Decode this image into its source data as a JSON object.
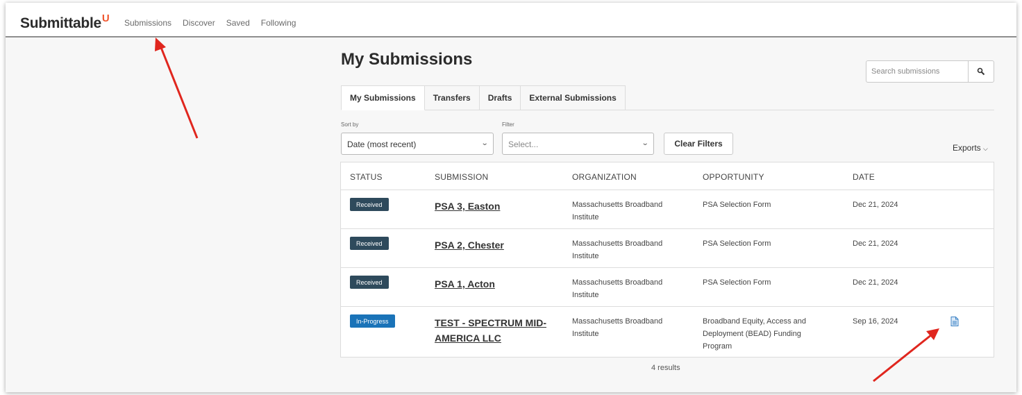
{
  "app": {
    "logo": "Submittable",
    "logo_mark": "U"
  },
  "nav": {
    "items": [
      "Submissions",
      "Discover",
      "Saved",
      "Following"
    ]
  },
  "page": {
    "title": "My Submissions"
  },
  "search": {
    "placeholder": "Search submissions",
    "icon": "search-icon"
  },
  "tabs": [
    {
      "label": "My Submissions",
      "active": true
    },
    {
      "label": "Transfers",
      "active": false
    },
    {
      "label": "Drafts",
      "active": false
    },
    {
      "label": "External Submissions",
      "active": false
    }
  ],
  "controls": {
    "sort_label": "Sort by",
    "sort_value": "Date (most recent)",
    "filter_label": "Filter",
    "filter_placeholder": "Select...",
    "clear_filters": "Clear Filters",
    "exports": "Exports"
  },
  "table": {
    "headers": [
      "STATUS",
      "SUBMISSION",
      "ORGANIZATION",
      "OPPORTUNITY",
      "DATE"
    ],
    "rows": [
      {
        "status": "Received",
        "submission": "PSA 3, Easton",
        "organization_l1": "Massachusetts Broadband",
        "organization_l2": "Institute",
        "opportunity": "PSA Selection Form",
        "date": "Dec 21, 2024"
      },
      {
        "status": "Received",
        "submission": "PSA 2, Chester",
        "organization_l1": "Massachusetts Broadband",
        "organization_l2": "Institute",
        "opportunity": "PSA Selection Form",
        "date": "Dec 21, 2024"
      },
      {
        "status": "Received",
        "submission": "PSA 1, Acton",
        "organization_l1": "Massachusetts Broadband",
        "organization_l2": "Institute",
        "opportunity": "PSA Selection Form",
        "date": "Dec 21, 2024"
      },
      {
        "status": "In-Progress",
        "submission": "TEST - SPECTRUM MID-AMERICA LLC",
        "organization_l1": "Massachusetts Broadband",
        "organization_l2": "Institute",
        "opportunity_l1": "Broadband Equity, Access and",
        "opportunity_l2": "Deployment (BEAD) Funding",
        "opportunity_l3": "Program",
        "date": "Sep 16, 2024",
        "icon": "document-icon"
      }
    ]
  },
  "results": "4 results",
  "colors": {
    "received_badge": "#2e4a5c",
    "in_progress_badge": "#1a73b8",
    "logo_accent": "#f0552d",
    "arrow": "#e0261e"
  }
}
